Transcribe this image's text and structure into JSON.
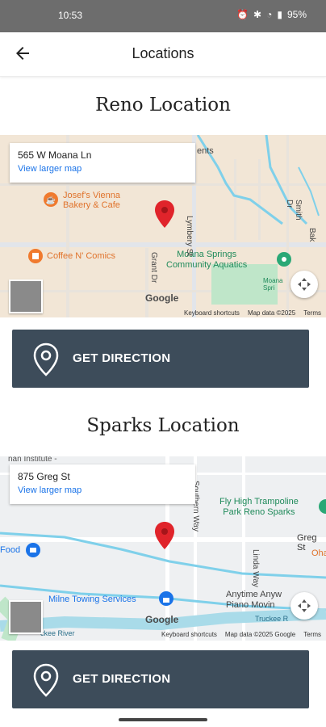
{
  "status_bar": {
    "time": "10:53",
    "battery": "95%"
  },
  "app_bar": {
    "title": "Locations"
  },
  "reno": {
    "title": "Reno Location",
    "address": "565 W Moana Ln",
    "view_larger": "View larger map",
    "places": [
      "Josef's Vienna\nBakery & Cafe",
      "Coffee N' Comics",
      "Moana Springs\nCommunity Aquatics",
      "Moana\nSpri"
    ],
    "streets": [
      "Lymbery St",
      "Grant Dr",
      "Smith Dr",
      "Bak",
      "ents"
    ],
    "keyboard_shortcuts": "Keyboard shortcuts",
    "map_data": "Map data ©2025",
    "terms": "Terms",
    "button": "GET DIRECTION"
  },
  "sparks": {
    "title": "Sparks Location",
    "address": "875 Greg St",
    "view_larger": "View larger map",
    "places": [
      "Fly High Trampoline\nPark Reno Sparks",
      "Milne Towing Services",
      "Anytime Anyw\nPiano Movin",
      "Food",
      "Oha",
      "nan Institute -"
    ],
    "streets": [
      "Southern Way",
      "Linda Way",
      "Greg St",
      "Truckee R",
      "ckee River"
    ],
    "keyboard_shortcuts": "Keyboard shortcuts",
    "map_data": "Map data ©2025 Google",
    "terms": "Terms",
    "button": "GET DIRECTION"
  },
  "google_logo": "Google",
  "colors": {
    "status_bar": "#6d6d6d",
    "button_bg": "#3d4c5a",
    "map_bg_reno": "#f2e6d6",
    "map_bg_sparks": "#eef0f2",
    "water": "#7fd0ea",
    "park": "#bfe6c9",
    "pin": "#e0242b",
    "poi_orange": "#f07a2e",
    "poi_green": "#2aa876",
    "poi_blue": "#1a73e8",
    "link": "#1a73e8"
  },
  "icons": [
    "back-arrow-icon",
    "location-pin-icon",
    "fullscreen-icon",
    "map-pin-icon",
    "cafe-icon",
    "shopping-icon",
    "pool-icon",
    "lock-icon",
    "wifi-icon",
    "battery-icon",
    "signal-icon",
    "bluetooth-icon",
    "alarm-icon"
  ]
}
